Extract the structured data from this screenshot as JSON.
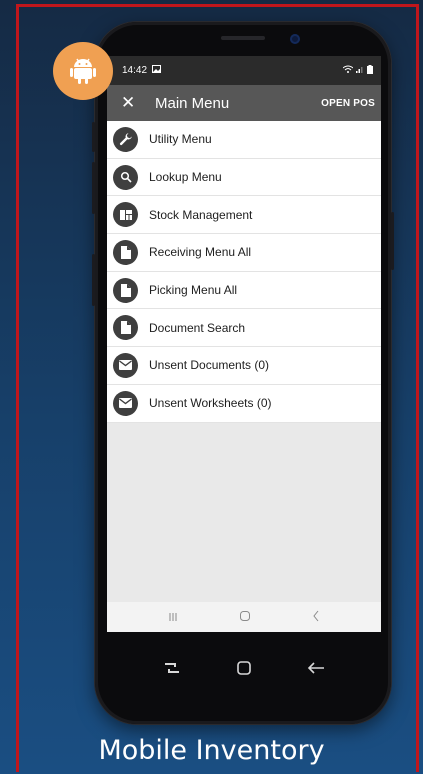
{
  "status_bar": {
    "time": "14:42"
  },
  "app_bar": {
    "title": "Main Menu",
    "action": "OPEN POS"
  },
  "menu": [
    {
      "label": "Utility Menu",
      "icon": "wrench-icon"
    },
    {
      "label": "Lookup Menu",
      "icon": "search-icon"
    },
    {
      "label": "Stock Management",
      "icon": "dashboard-icon"
    },
    {
      "label": "Receiving Menu All",
      "icon": "document-icon"
    },
    {
      "label": "Picking Menu All",
      "icon": "document-icon"
    },
    {
      "label": "Document Search",
      "icon": "document-icon"
    },
    {
      "label": "Unsent Documents (0)",
      "icon": "mail-icon"
    },
    {
      "label": "Unsent Worksheets (0)",
      "icon": "mail-icon"
    }
  ],
  "caption": "Mobile Inventory",
  "colors": {
    "badge": "#f0a052",
    "frame": "#c0161c",
    "app_bar": "#575757",
    "icon_circle": "#3f3f3f"
  }
}
